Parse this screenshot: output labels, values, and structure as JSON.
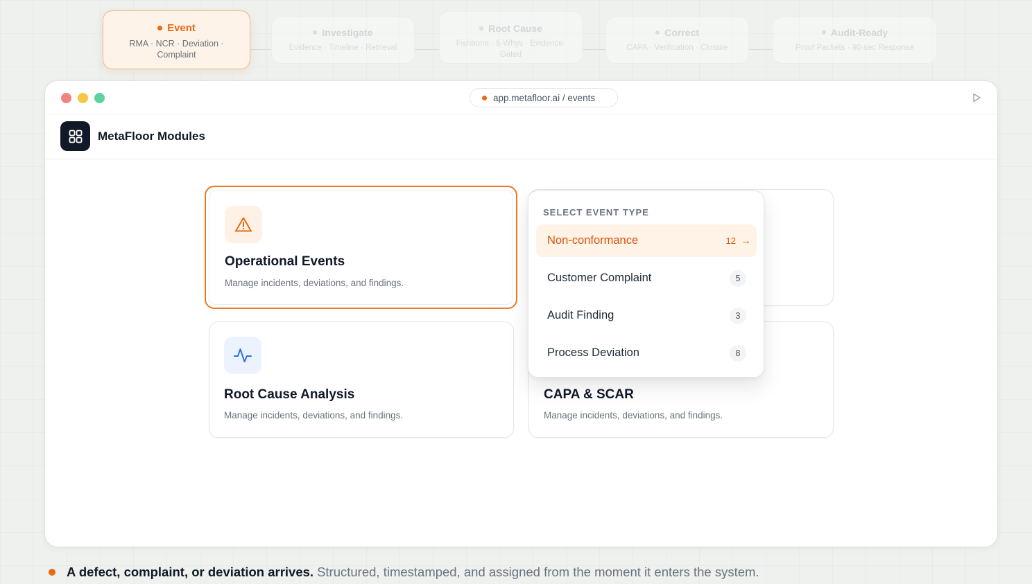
{
  "steps": [
    {
      "title": "Event",
      "subtitle": "RMA · NCR · Deviation · Complaint",
      "active": true
    },
    {
      "title": "Investigate",
      "subtitle": "Evidence · Timeline · Retrieval",
      "active": false
    },
    {
      "title": "Root Cause",
      "subtitle": "Fishbone · 5-Whys · Evidence-Gated",
      "active": false
    },
    {
      "title": "Correct",
      "subtitle": "CAPA · Verification · Closure",
      "active": false
    },
    {
      "title": "Audit-Ready",
      "subtitle": "Proof Packets · 90-sec Response",
      "active": false
    }
  ],
  "window": {
    "url": "app.metafloor.ai / events",
    "app_title": "MetaFloor Modules"
  },
  "cards": [
    {
      "title": "Operational Events",
      "description": "Manage incidents, deviations, and findings.",
      "icon": "warning-triangle-icon"
    },
    {
      "title": "Root Cause Analysis",
      "description": "Manage incidents, deviations, and findings.",
      "icon": "activity-pulse-icon"
    },
    {
      "title": "CAPA & SCAR",
      "description": "Manage incidents, deviations, and findings."
    }
  ],
  "dropdown": {
    "header": "SELECT EVENT TYPE",
    "items": [
      {
        "label": "Non-conformance",
        "count": "12",
        "active": true
      },
      {
        "label": "Customer Complaint",
        "count": "5"
      },
      {
        "label": "Audit Finding",
        "count": "3"
      },
      {
        "label": "Process Deviation",
        "count": "8"
      }
    ]
  },
  "caption": {
    "bold": "A defect, complaint, or deviation arrives.",
    "rest": "Structured, timestamped, and assigned from the moment it enters the system."
  },
  "colors": {
    "accent": "#ea6a12",
    "traffic_red": "#f0847f",
    "traffic_yellow": "#f6c744",
    "traffic_green": "#5dd39b"
  }
}
